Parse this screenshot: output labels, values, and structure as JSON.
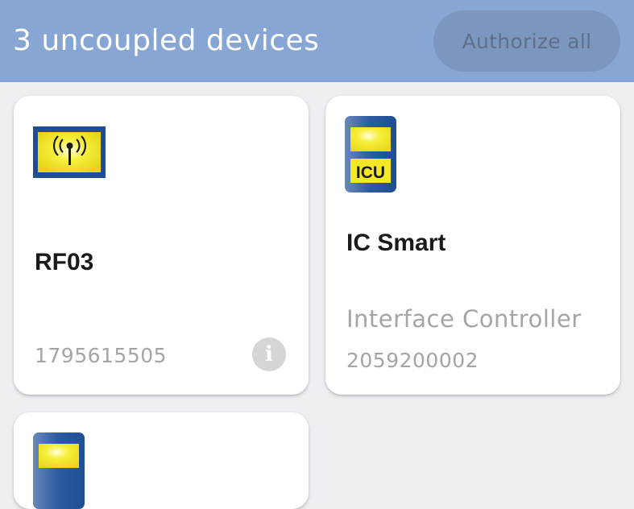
{
  "header": {
    "title": "3 uncoupled devices",
    "authorize_all_label": "Authorize all"
  },
  "devices": [
    {
      "name": "RF03",
      "description": "",
      "serial": "1795615505",
      "icon": "rf-antenna-icon",
      "has_info": true
    },
    {
      "name": "IC Smart",
      "description": "Interface Controller",
      "serial": "2059200002",
      "icon": "icu-module-icon",
      "icon_label": "ICU",
      "has_info": false
    },
    {
      "name": "",
      "description": "",
      "serial": "",
      "icon": "icu-module-icon"
    }
  ],
  "colors": {
    "header_bg": "#88a6d3",
    "button_bg": "#7c97bf",
    "page_bg": "#eeeef3",
    "icon_blue": "#1f4f92",
    "icon_yellow": "#f5e825"
  }
}
